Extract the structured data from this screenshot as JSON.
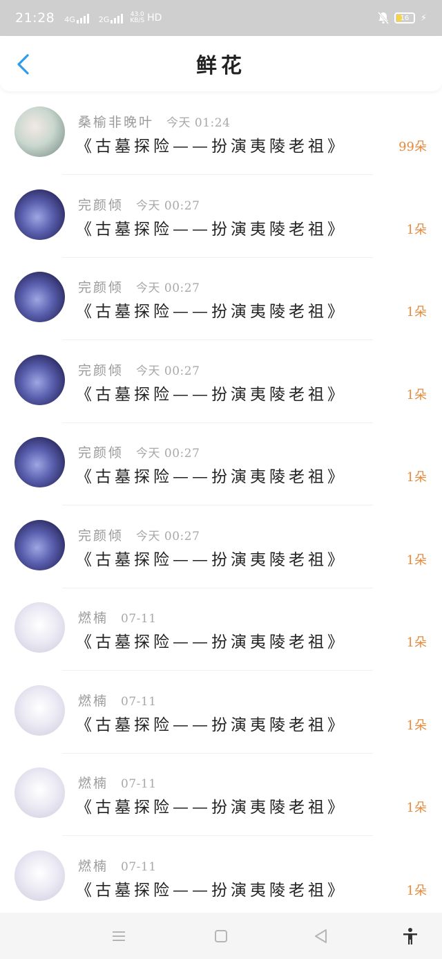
{
  "status_bar": {
    "time": "21:28",
    "network_1": "4G",
    "network_2": "2G",
    "speed_value": "43.0",
    "speed_unit": "KB/S",
    "hd": "HD",
    "battery": "16"
  },
  "header": {
    "title": "鲜花",
    "back_icon": "chevron-left-icon",
    "accent_color": "#2f9bea"
  },
  "list": [
    {
      "name": "桑榆非晚叶",
      "time": "今天 01:24",
      "book": "《古墓探险——扮演夷陵老祖》",
      "count": "99朵",
      "avatar": "style-a"
    },
    {
      "name": "完颜倾",
      "time": "今天 00:27",
      "book": "《古墓探险——扮演夷陵老祖》",
      "count": "1朵",
      "avatar": "style-b"
    },
    {
      "name": "完颜倾",
      "time": "今天 00:27",
      "book": "《古墓探险——扮演夷陵老祖》",
      "count": "1朵",
      "avatar": "style-b"
    },
    {
      "name": "完颜倾",
      "time": "今天 00:27",
      "book": "《古墓探险——扮演夷陵老祖》",
      "count": "1朵",
      "avatar": "style-b"
    },
    {
      "name": "完颜倾",
      "time": "今天 00:27",
      "book": "《古墓探险——扮演夷陵老祖》",
      "count": "1朵",
      "avatar": "style-b"
    },
    {
      "name": "完颜倾",
      "time": "今天 00:27",
      "book": "《古墓探险——扮演夷陵老祖》",
      "count": "1朵",
      "avatar": "style-b"
    },
    {
      "name": "燃楠",
      "time": "07-11",
      "book": "《古墓探险——扮演夷陵老祖》",
      "count": "1朵",
      "avatar": "style-c"
    },
    {
      "name": "燃楠",
      "time": "07-11",
      "book": "《古墓探险——扮演夷陵老祖》",
      "count": "1朵",
      "avatar": "style-c"
    },
    {
      "name": "燃楠",
      "time": "07-11",
      "book": "《古墓探险——扮演夷陵老祖》",
      "count": "1朵",
      "avatar": "style-c"
    },
    {
      "name": "燃楠",
      "time": "07-11",
      "book": "《古墓探险——扮演夷陵老祖》",
      "count": "1朵",
      "avatar": "style-c"
    }
  ],
  "colors": {
    "count": "#e58a3c",
    "name": "#9a9a9a"
  },
  "nav_bar": {
    "icons": [
      "menu-icon",
      "home-square-icon",
      "back-triangle-icon",
      "accessibility-icon"
    ]
  }
}
